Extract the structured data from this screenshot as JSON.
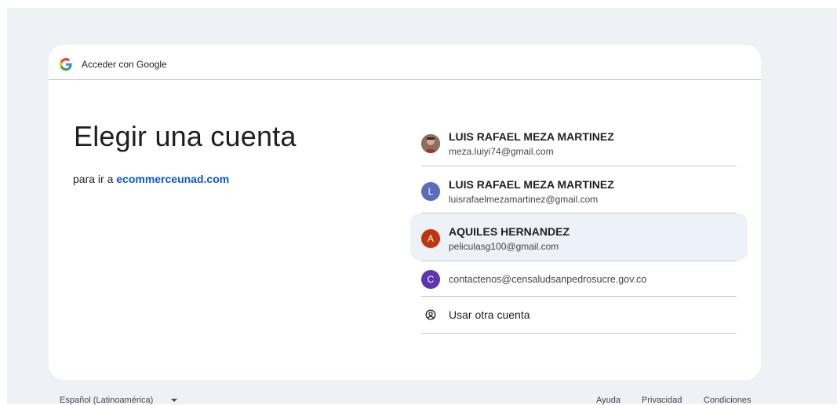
{
  "header": {
    "title": "Acceder con Google"
  },
  "main": {
    "title": "Elegir una cuenta",
    "subtitle_prefix": "para ir a",
    "subtitle_link": "ecommerceunad.com"
  },
  "accounts": [
    {
      "name": "LUIS RAFAEL MEZA MARTINEZ",
      "email": "meza.luiyi74@gmail.com",
      "avatar": "photo"
    },
    {
      "name": "LUIS RAFAEL MEZA MARTINEZ",
      "email": "luisrafaelmezamartinez@gmail.com",
      "avatar": "L",
      "color": "#5c6bc0"
    },
    {
      "name": "AQUILES HERNANDEZ",
      "email": "peliculasg100@gmail.com",
      "avatar": "A",
      "color": "#bf360c"
    },
    {
      "email": "contactenos@censaludsanpedrosucre.gov.co",
      "avatar": "C",
      "color": "#5e35b1"
    }
  ],
  "other_account": {
    "label": "Usar otra cuenta",
    "icon": "account-circle-icon"
  },
  "footer": {
    "language": "Español (Latinoamérica)",
    "help": "Ayuda",
    "privacy": "Privacidad",
    "terms": "Condiciones"
  }
}
